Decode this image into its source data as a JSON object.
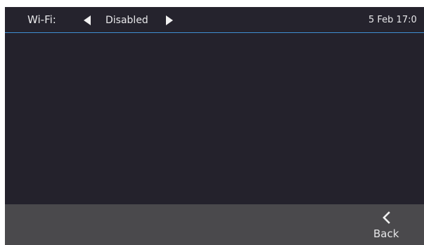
{
  "header": {
    "setting_label": "Wi-Fi:",
    "setting_value": "Disabled",
    "datetime": "5 Feb 17:0"
  },
  "footer": {
    "back_label": "Back"
  },
  "icons": {
    "prev": "caret-left-icon",
    "next": "caret-right-icon",
    "back": "chevron-left-icon"
  },
  "colors": {
    "background": "#25232d",
    "footer": "#4a494c",
    "accent_line": "#3f8fd2",
    "text": "#e8e8ea"
  }
}
